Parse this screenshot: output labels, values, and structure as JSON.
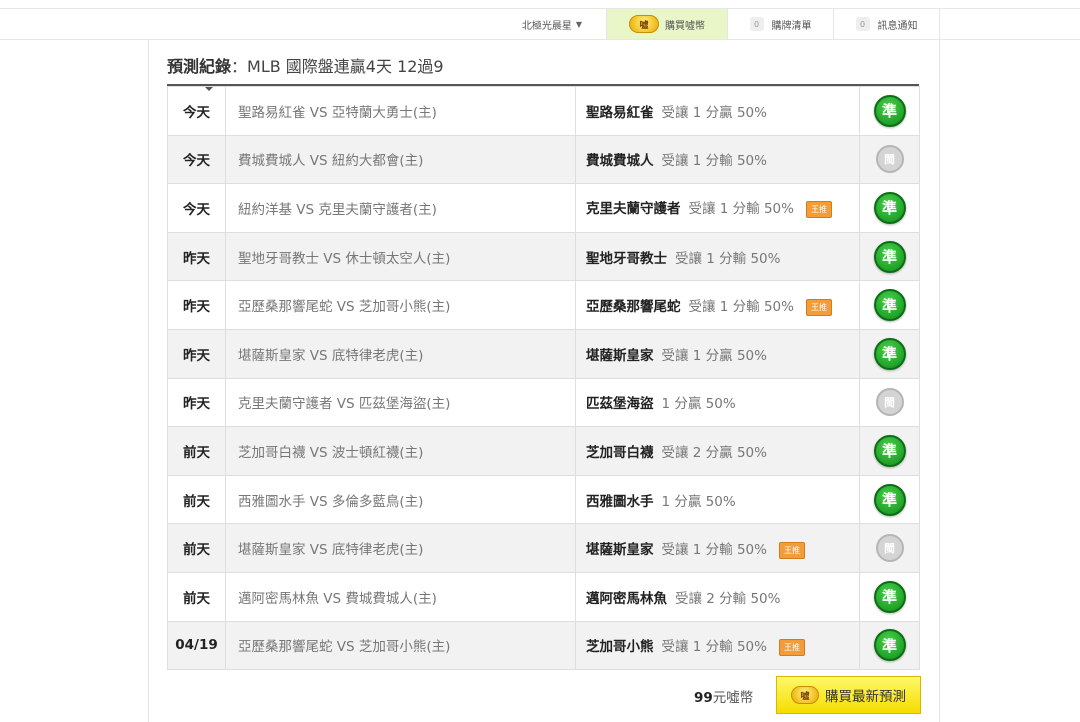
{
  "header": {
    "user": "北極光晨星",
    "buy_coin": "購買噓幣",
    "coin_icon_text": "噓",
    "cart_count": "0",
    "cart_label": "購牌清單",
    "msg_count": "0",
    "msg_label": "訊息通知"
  },
  "panel": {
    "title_bold": "預測紀錄",
    "title_rest": "：MLB 國際盤連贏4天 12過9"
  },
  "records": [
    {
      "day": "今天",
      "match": "聖路易紅雀 VS 亞特蘭大勇士(主)",
      "team": "聖路易紅雀",
      "line": "受讓 1 分贏 50%",
      "king": false,
      "result": "準"
    },
    {
      "day": "今天",
      "match": "費城費城人 VS 紐約大都會(主)",
      "team": "費城費城人",
      "line": "受讓 1 分輸 50%",
      "king": false,
      "result": "閩"
    },
    {
      "day": "今天",
      "match": "紐約洋基 VS 克里夫蘭守護者(主)",
      "team": "克里夫蘭守護者",
      "line": "受讓 1 分輸 50%",
      "king": true,
      "result": "準"
    },
    {
      "day": "昨天",
      "match": "聖地牙哥教士 VS 休士頓太空人(主)",
      "team": "聖地牙哥教士",
      "line": "受讓 1 分輸 50%",
      "king": false,
      "result": "準"
    },
    {
      "day": "昨天",
      "match": "亞歷桑那響尾蛇 VS 芝加哥小熊(主)",
      "team": "亞歷桑那響尾蛇",
      "line": "受讓 1 分輸 50%",
      "king": true,
      "result": "準"
    },
    {
      "day": "昨天",
      "match": "堪薩斯皇家 VS 底特律老虎(主)",
      "team": "堪薩斯皇家",
      "line": "受讓 1 分贏 50%",
      "king": false,
      "result": "準"
    },
    {
      "day": "昨天",
      "match": "克里夫蘭守護者 VS 匹茲堡海盜(主)",
      "team": "匹茲堡海盜",
      "line": "1 分贏 50%",
      "king": false,
      "result": "閩"
    },
    {
      "day": "前天",
      "match": "芝加哥白襪 VS 波士頓紅襪(主)",
      "team": "芝加哥白襪",
      "line": "受讓 2 分贏 50%",
      "king": false,
      "result": "準"
    },
    {
      "day": "前天",
      "match": "西雅圖水手 VS 多倫多藍鳥(主)",
      "team": "西雅圖水手",
      "line": "1 分贏 50%",
      "king": false,
      "result": "準"
    },
    {
      "day": "前天",
      "match": "堪薩斯皇家 VS 底特律老虎(主)",
      "team": "堪薩斯皇家",
      "line": "受讓 1 分輸 50%",
      "king": true,
      "result": "閩"
    },
    {
      "day": "前天",
      "match": "邁阿密馬林魚 VS 費城費城人(主)",
      "team": "邁阿密馬林魚",
      "line": "受讓 2 分輸 50%",
      "king": false,
      "result": "準"
    },
    {
      "day": "04/19",
      "match": "亞歷桑那響尾蛇 VS 芝加哥小熊(主)",
      "team": "芝加哥小熊",
      "line": "受讓 1 分輸 50%",
      "king": true,
      "result": "準"
    }
  ],
  "king_label": "王推",
  "footer": {
    "price_value": "99",
    "price_unit": "元噓幣",
    "buy_label": "購買最新預測"
  },
  "colors": {
    "win": "#1a9e22",
    "lost": "#c8c8c8",
    "buy": "#f5dd00",
    "king": "#f39c3a"
  }
}
